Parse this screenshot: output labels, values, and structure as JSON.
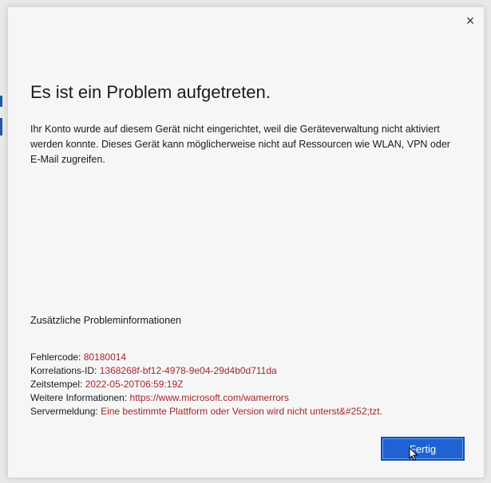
{
  "dialog": {
    "close_glyph": "×",
    "title": "Es ist ein Problem aufgetreten.",
    "message": "Ihr Konto wurde auf diesem Gerät nicht eingerichtet, weil die Geräteverwaltung nicht aktiviert werden konnte. Dieses Gerät kann möglicherweise nicht auf Ressourcen wie WLAN, VPN oder E-Mail zugreifen.",
    "additional_heading": "Zusätzliche Probleminformationen",
    "details": [
      {
        "label": "Fehlercode:",
        "value": "80180014"
      },
      {
        "label": "Korrelations-ID:",
        "value": "1368268f-bf12-4978-9e04-29d4b0d711da"
      },
      {
        "label": "Zeitstempel:",
        "value": "2022-05-20T06:59:19Z"
      },
      {
        "label": "Weitere Informationen:",
        "value": "https://www.microsoft.com/wamerrors"
      },
      {
        "label": "Servermeldung:",
        "value": "Eine bestimmte Plattform oder Version wird nicht unterst&#252;tzt."
      }
    ],
    "done_label": "Fertig"
  },
  "colors": {
    "accent_button": "#1f63d3",
    "value_text": "#a4262c",
    "dialog_bg": "#f6f6f6"
  },
  "icons": {
    "close": "close-icon",
    "cursor": "mouse-pointer-icon"
  }
}
